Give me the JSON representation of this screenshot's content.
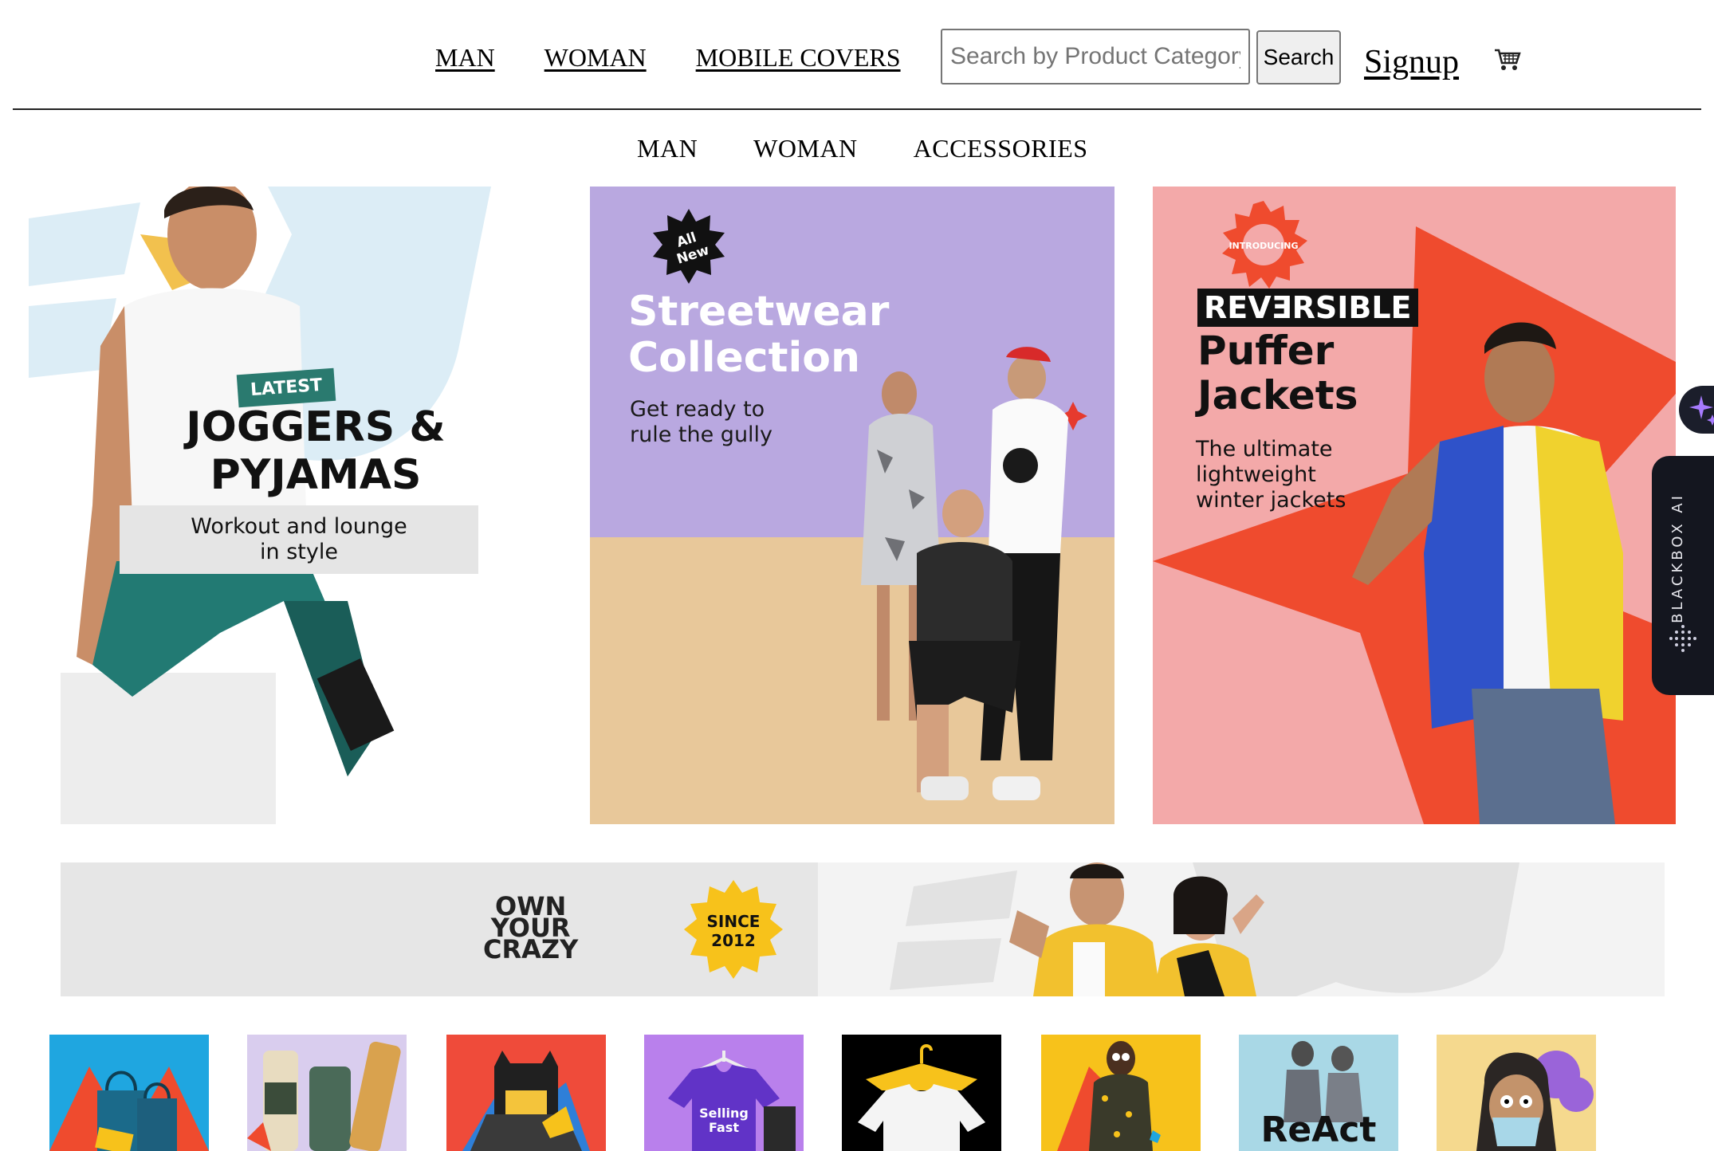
{
  "header": {
    "nav": [
      "MAN",
      "WOMAN",
      "MOBILE COVERS"
    ],
    "search_placeholder": "Search by Product Category",
    "search_button": "Search",
    "signup": "Signup"
  },
  "subnav": [
    "MAN",
    "WOMAN",
    "ACCESSORIES"
  ],
  "banners": {
    "joggers": {
      "tag": "LATEST",
      "title": "JOGGERS & PYJAMAS",
      "subtitle": "Workout and lounge\nin style"
    },
    "streetwear": {
      "badge": "All New",
      "title": "Streetwear\nCollection",
      "subtitle": "Get ready to\nrule the gully"
    },
    "puffer": {
      "badge": "INTRODUCING",
      "highlight": "REVƎRSIBLE",
      "title": "Puffer\nJackets",
      "subtitle": "The ultimate\nlightweight\nwinter jackets"
    }
  },
  "promo": {
    "tagline": "OWN\nYOUR\nCRAZY",
    "since": "SINCE\n2012"
  },
  "tiles": {
    "selling_fast": "Selling\nFast",
    "react": "ReAct"
  },
  "widget": {
    "label": "BLACKBOX AI"
  },
  "colors": {
    "streetwear_bg": "#b9a8e0",
    "puffer_bg": "#f3a9a9",
    "promo_bg": "#e6e6e6",
    "accent_teal": "#2a7a6f",
    "accent_yellow": "#f7c21b"
  },
  "icons": {
    "cart": "shopping-cart-icon",
    "ai": "sparkle-icon"
  }
}
